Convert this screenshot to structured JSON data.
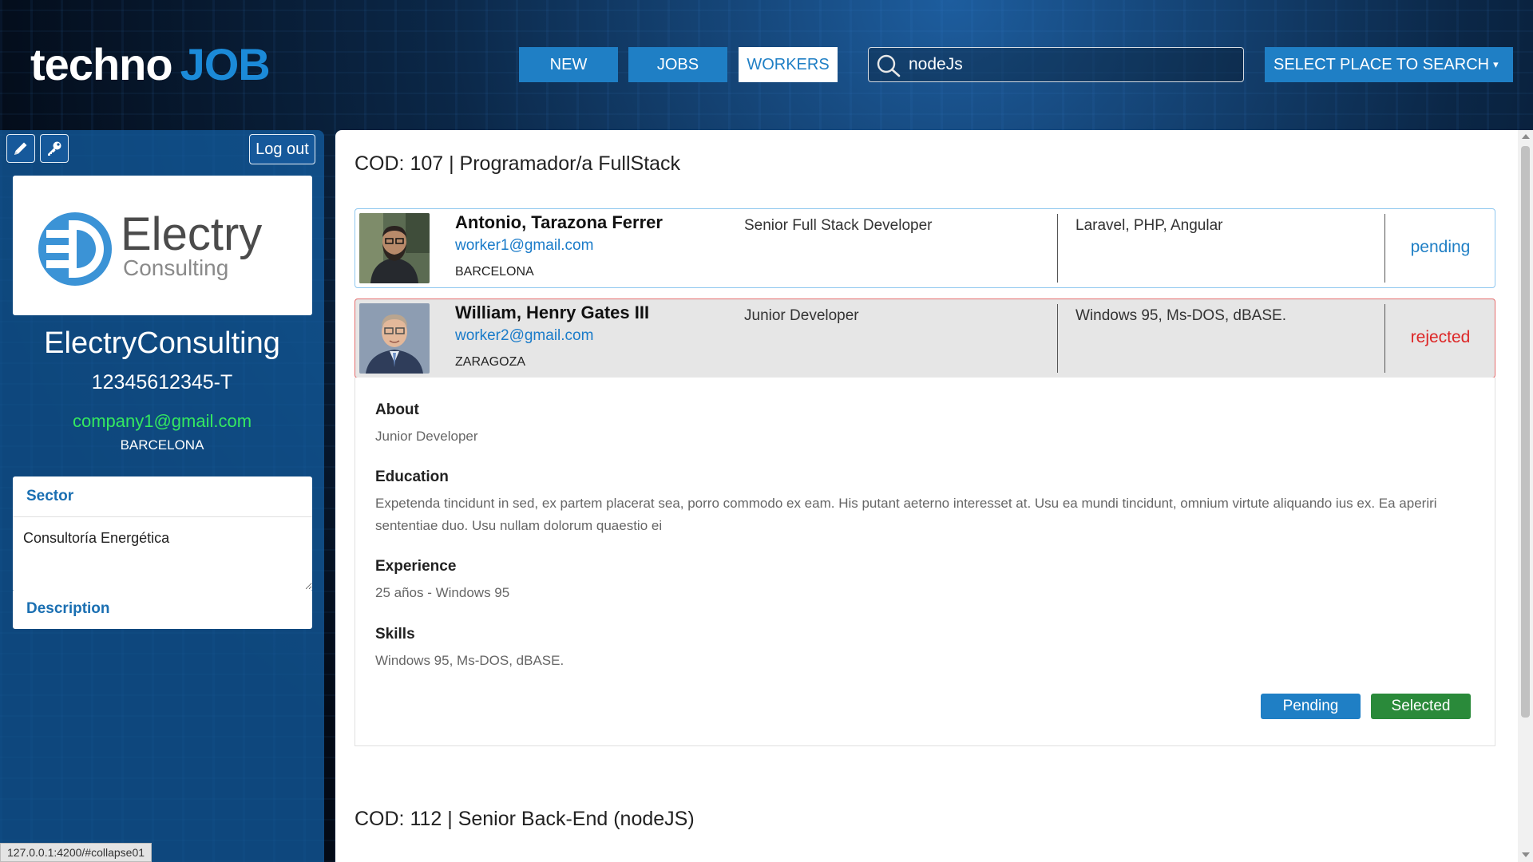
{
  "brand": {
    "part1": "techno",
    "part2": "JOB"
  },
  "nav": {
    "new": "NEW",
    "jobs": "JOBS",
    "workers": "WORKERS"
  },
  "search": {
    "value": "nodeJs",
    "icon": "search-icon"
  },
  "place_button": {
    "label": "SELECT PLACE TO SEARCH",
    "caret": "▾"
  },
  "sidebar": {
    "edit_icon": "pencil-icon",
    "key_icon": "key-icon",
    "logout_label": "Log out",
    "logo": {
      "line1": "Electry",
      "line2": "Consulting"
    },
    "company_name": "ElectryConsulting",
    "company_id": "12345612345-T",
    "email": "company1@gmail.com",
    "city": "BARCELONA",
    "sector_label": "Sector",
    "sector_value": "Consultoría Energética",
    "description_label": "Description"
  },
  "status_url": "127.0.0.1:4200/#collapse01",
  "jobs": [
    {
      "title": "COD: 107 | Programador/a FullStack",
      "applicants": [
        {
          "name": "Antonio, Tarazona Ferrer",
          "email": "worker1@gmail.com",
          "city": "BARCELONA",
          "position": "Senior Full Stack Developer",
          "skills": "Laravel, PHP, Angular",
          "status": "pending"
        },
        {
          "name": "William, Henry Gates III",
          "email": "worker2@gmail.com",
          "city": "ZARAGOZA",
          "position": "Junior Developer",
          "skills": "Windows 95, Ms-DOS, dBASE.",
          "status": "rejected"
        }
      ]
    },
    {
      "title": "COD: 112 | Senior Back-End (nodeJS)"
    }
  ],
  "detail": {
    "about_label": "About",
    "about": "Junior Developer",
    "education_label": "Education",
    "education": "Expetenda tincidunt in sed, ex partem placerat sea, porro commodo ex eam. His putant aeterno interesset at. Usu ea mundi tincidunt, omnium virtute aliquando ius ex. Ea aperiri sententiae duo. Usu nullam dolorum quaestio ei",
    "experience_label": "Experience",
    "experience": "25 años - Windows 95",
    "skills_label": "Skills",
    "skills": "Windows 95, Ms-DOS, dBASE.",
    "pending_button": "Pending",
    "selected_button": "Selected"
  },
  "colors": {
    "primary": "#1f7fc5",
    "selected_green": "#2a8a3a",
    "rejected_red": "#dd2626",
    "email_green": "#34e860"
  }
}
